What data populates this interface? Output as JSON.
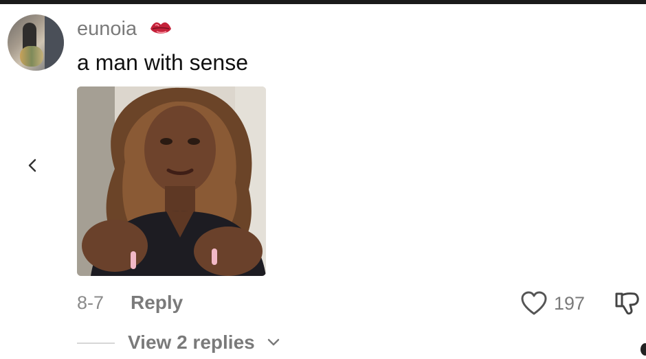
{
  "comment": {
    "username": "eunoia",
    "username_emoji": "lips-kiss-icon",
    "text": "a man with sense",
    "date": "8-7",
    "reply_label": "Reply",
    "like_count": "197",
    "view_replies_label": "View 2 replies"
  },
  "colors": {
    "muted_text": "#7a7a7a",
    "primary_text": "#111111",
    "lips": "#c4223a"
  }
}
